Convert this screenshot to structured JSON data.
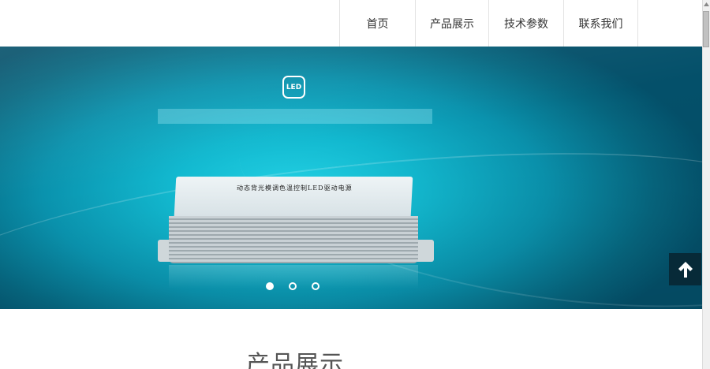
{
  "nav": {
    "items": [
      {
        "label": "首页"
      },
      {
        "label": "产品展示"
      },
      {
        "label": "技术参数"
      },
      {
        "label": "联系我们"
      }
    ]
  },
  "banner": {
    "badge_text": "LED",
    "product_label": "动态背光模调色温控制LED驱动电源",
    "slides": 3,
    "active_slide": 1
  },
  "section": {
    "title": "产品展示"
  },
  "icons": {
    "back_to_top": "arrow-up-icon"
  },
  "colors": {
    "banner_center": "#23d3e6",
    "banner_edge": "#04506a",
    "to_top_bg": "#072a38"
  }
}
